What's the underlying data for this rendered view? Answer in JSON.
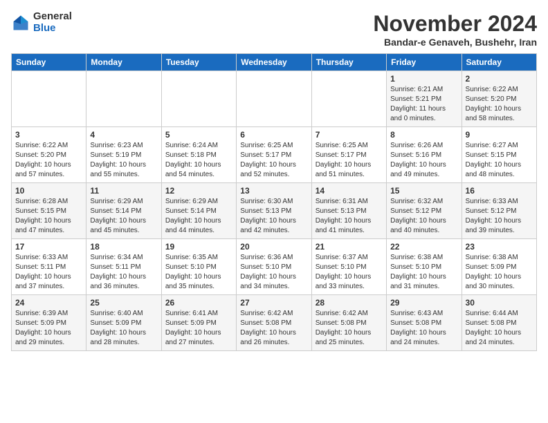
{
  "logo": {
    "general": "General",
    "blue": "Blue"
  },
  "header": {
    "month": "November 2024",
    "location": "Bandar-e Genaveh, Bushehr, Iran"
  },
  "weekdays": [
    "Sunday",
    "Monday",
    "Tuesday",
    "Wednesday",
    "Thursday",
    "Friday",
    "Saturday"
  ],
  "weeks": [
    [
      {
        "day": "",
        "content": ""
      },
      {
        "day": "",
        "content": ""
      },
      {
        "day": "",
        "content": ""
      },
      {
        "day": "",
        "content": ""
      },
      {
        "day": "",
        "content": ""
      },
      {
        "day": "1",
        "content": "Sunrise: 6:21 AM\nSunset: 5:21 PM\nDaylight: 11 hours and 0 minutes."
      },
      {
        "day": "2",
        "content": "Sunrise: 6:22 AM\nSunset: 5:20 PM\nDaylight: 10 hours and 58 minutes."
      }
    ],
    [
      {
        "day": "3",
        "content": "Sunrise: 6:22 AM\nSunset: 5:20 PM\nDaylight: 10 hours and 57 minutes."
      },
      {
        "day": "4",
        "content": "Sunrise: 6:23 AM\nSunset: 5:19 PM\nDaylight: 10 hours and 55 minutes."
      },
      {
        "day": "5",
        "content": "Sunrise: 6:24 AM\nSunset: 5:18 PM\nDaylight: 10 hours and 54 minutes."
      },
      {
        "day": "6",
        "content": "Sunrise: 6:25 AM\nSunset: 5:17 PM\nDaylight: 10 hours and 52 minutes."
      },
      {
        "day": "7",
        "content": "Sunrise: 6:25 AM\nSunset: 5:17 PM\nDaylight: 10 hours and 51 minutes."
      },
      {
        "day": "8",
        "content": "Sunrise: 6:26 AM\nSunset: 5:16 PM\nDaylight: 10 hours and 49 minutes."
      },
      {
        "day": "9",
        "content": "Sunrise: 6:27 AM\nSunset: 5:15 PM\nDaylight: 10 hours and 48 minutes."
      }
    ],
    [
      {
        "day": "10",
        "content": "Sunrise: 6:28 AM\nSunset: 5:15 PM\nDaylight: 10 hours and 47 minutes."
      },
      {
        "day": "11",
        "content": "Sunrise: 6:29 AM\nSunset: 5:14 PM\nDaylight: 10 hours and 45 minutes."
      },
      {
        "day": "12",
        "content": "Sunrise: 6:29 AM\nSunset: 5:14 PM\nDaylight: 10 hours and 44 minutes."
      },
      {
        "day": "13",
        "content": "Sunrise: 6:30 AM\nSunset: 5:13 PM\nDaylight: 10 hours and 42 minutes."
      },
      {
        "day": "14",
        "content": "Sunrise: 6:31 AM\nSunset: 5:13 PM\nDaylight: 10 hours and 41 minutes."
      },
      {
        "day": "15",
        "content": "Sunrise: 6:32 AM\nSunset: 5:12 PM\nDaylight: 10 hours and 40 minutes."
      },
      {
        "day": "16",
        "content": "Sunrise: 6:33 AM\nSunset: 5:12 PM\nDaylight: 10 hours and 39 minutes."
      }
    ],
    [
      {
        "day": "17",
        "content": "Sunrise: 6:33 AM\nSunset: 5:11 PM\nDaylight: 10 hours and 37 minutes."
      },
      {
        "day": "18",
        "content": "Sunrise: 6:34 AM\nSunset: 5:11 PM\nDaylight: 10 hours and 36 minutes."
      },
      {
        "day": "19",
        "content": "Sunrise: 6:35 AM\nSunset: 5:10 PM\nDaylight: 10 hours and 35 minutes."
      },
      {
        "day": "20",
        "content": "Sunrise: 6:36 AM\nSunset: 5:10 PM\nDaylight: 10 hours and 34 minutes."
      },
      {
        "day": "21",
        "content": "Sunrise: 6:37 AM\nSunset: 5:10 PM\nDaylight: 10 hours and 33 minutes."
      },
      {
        "day": "22",
        "content": "Sunrise: 6:38 AM\nSunset: 5:10 PM\nDaylight: 10 hours and 31 minutes."
      },
      {
        "day": "23",
        "content": "Sunrise: 6:38 AM\nSunset: 5:09 PM\nDaylight: 10 hours and 30 minutes."
      }
    ],
    [
      {
        "day": "24",
        "content": "Sunrise: 6:39 AM\nSunset: 5:09 PM\nDaylight: 10 hours and 29 minutes."
      },
      {
        "day": "25",
        "content": "Sunrise: 6:40 AM\nSunset: 5:09 PM\nDaylight: 10 hours and 28 minutes."
      },
      {
        "day": "26",
        "content": "Sunrise: 6:41 AM\nSunset: 5:09 PM\nDaylight: 10 hours and 27 minutes."
      },
      {
        "day": "27",
        "content": "Sunrise: 6:42 AM\nSunset: 5:08 PM\nDaylight: 10 hours and 26 minutes."
      },
      {
        "day": "28",
        "content": "Sunrise: 6:42 AM\nSunset: 5:08 PM\nDaylight: 10 hours and 25 minutes."
      },
      {
        "day": "29",
        "content": "Sunrise: 6:43 AM\nSunset: 5:08 PM\nDaylight: 10 hours and 24 minutes."
      },
      {
        "day": "30",
        "content": "Sunrise: 6:44 AM\nSunset: 5:08 PM\nDaylight: 10 hours and 24 minutes."
      }
    ]
  ]
}
